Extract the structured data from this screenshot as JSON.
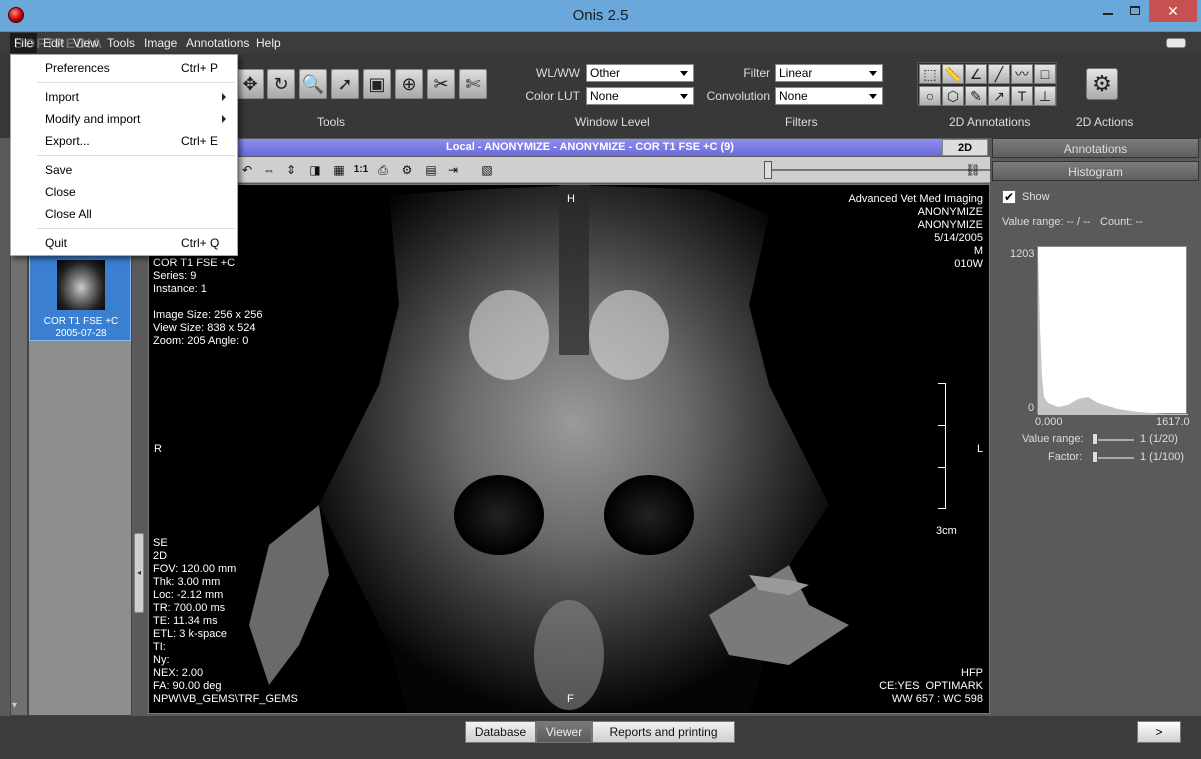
{
  "window": {
    "title": "Onis 2.5",
    "min": "",
    "max": "",
    "close": "✕"
  },
  "menubar": {
    "items": [
      "File",
      "Edit",
      "View",
      "Tools",
      "Image",
      "Annotations",
      "Help"
    ]
  },
  "toolbar": {
    "wlww_label": "WL/WW",
    "wlww_value": "Other",
    "colorlut_label": "Color LUT",
    "colorlut_value": "None",
    "filter_label": "Filter",
    "filter_value": "Linear",
    "convolution_label": "Convolution",
    "convolution_value": "None",
    "sections": [
      "Tools",
      "Window Level",
      "Filters",
      "2D Annotations",
      "2D Actions"
    ]
  },
  "file_menu": {
    "preferences": "Preferences",
    "preferences_sc": "Ctrl+ P",
    "import": "Import",
    "modify_import": "Modify and import",
    "export": "Export...",
    "export_sc": "Ctrl+ E",
    "save": "Save",
    "close": "Close",
    "close_all": "Close All",
    "quit": "Quit",
    "quit_sc": "Ctrl+ Q"
  },
  "series": {
    "label": "COR T1 FSE +C",
    "date": "2005-07-28"
  },
  "viewer": {
    "title": "Local - ANONYMIZE - ANONYMIZE - COR T1 FSE +C (9)",
    "tab_2d": "2D",
    "scale_zoom": "1:1",
    "orient_top": "H",
    "orient_bottom": "F",
    "orient_left": "R",
    "orient_right": "L",
    "overlay_tl": "COR T1 FSE +C\nSeries: 9\nInstance: 1\n\nImage Size: 256 x 256\nView Size: 838 x 524\nZoom: 205 Angle: 0",
    "overlay_tr": "Advanced Vet Med Imaging\nANONYMIZE\nANONYMIZE\n5/14/2005\nM\n010W",
    "overlay_bl": "SE\n2D\nFOV: 120.00 mm\nThk: 3.00 mm\nLoc: -2.12 mm\nTR: 700.00 ms\nTE: 11.34 ms\nETL: 3 k-space\nTI:\nNy:\nNEX: 2.00\nFA: 90.00 deg\nNPW\\VB_GEMS\\TRF_GEMS",
    "overlay_br": "HFP\nCE:YES  OPTIMARK\nWW 657 : WC 598",
    "scale_label": "3cm"
  },
  "right_panel": {
    "annotations": "Annotations",
    "histogram": "Histogram",
    "show_label": "Show",
    "show_checked": "✔",
    "value_range_info": "Value range: -- / --",
    "count_info": "Count: --",
    "histo_ymax": "1203",
    "histo_ymin": "0",
    "histo_xmin": "0.000",
    "histo_xmax": "1617.0",
    "value_range_label": "Value range:",
    "value_range_val": "1 (1/20)",
    "factor_label": "Factor:",
    "factor_val": "1 (1/100)"
  },
  "bottom": {
    "database": "Database",
    "viewer": "Viewer",
    "reports": "Reports and printing",
    "next": ">"
  },
  "watermark": "SOFTPEDIA"
}
